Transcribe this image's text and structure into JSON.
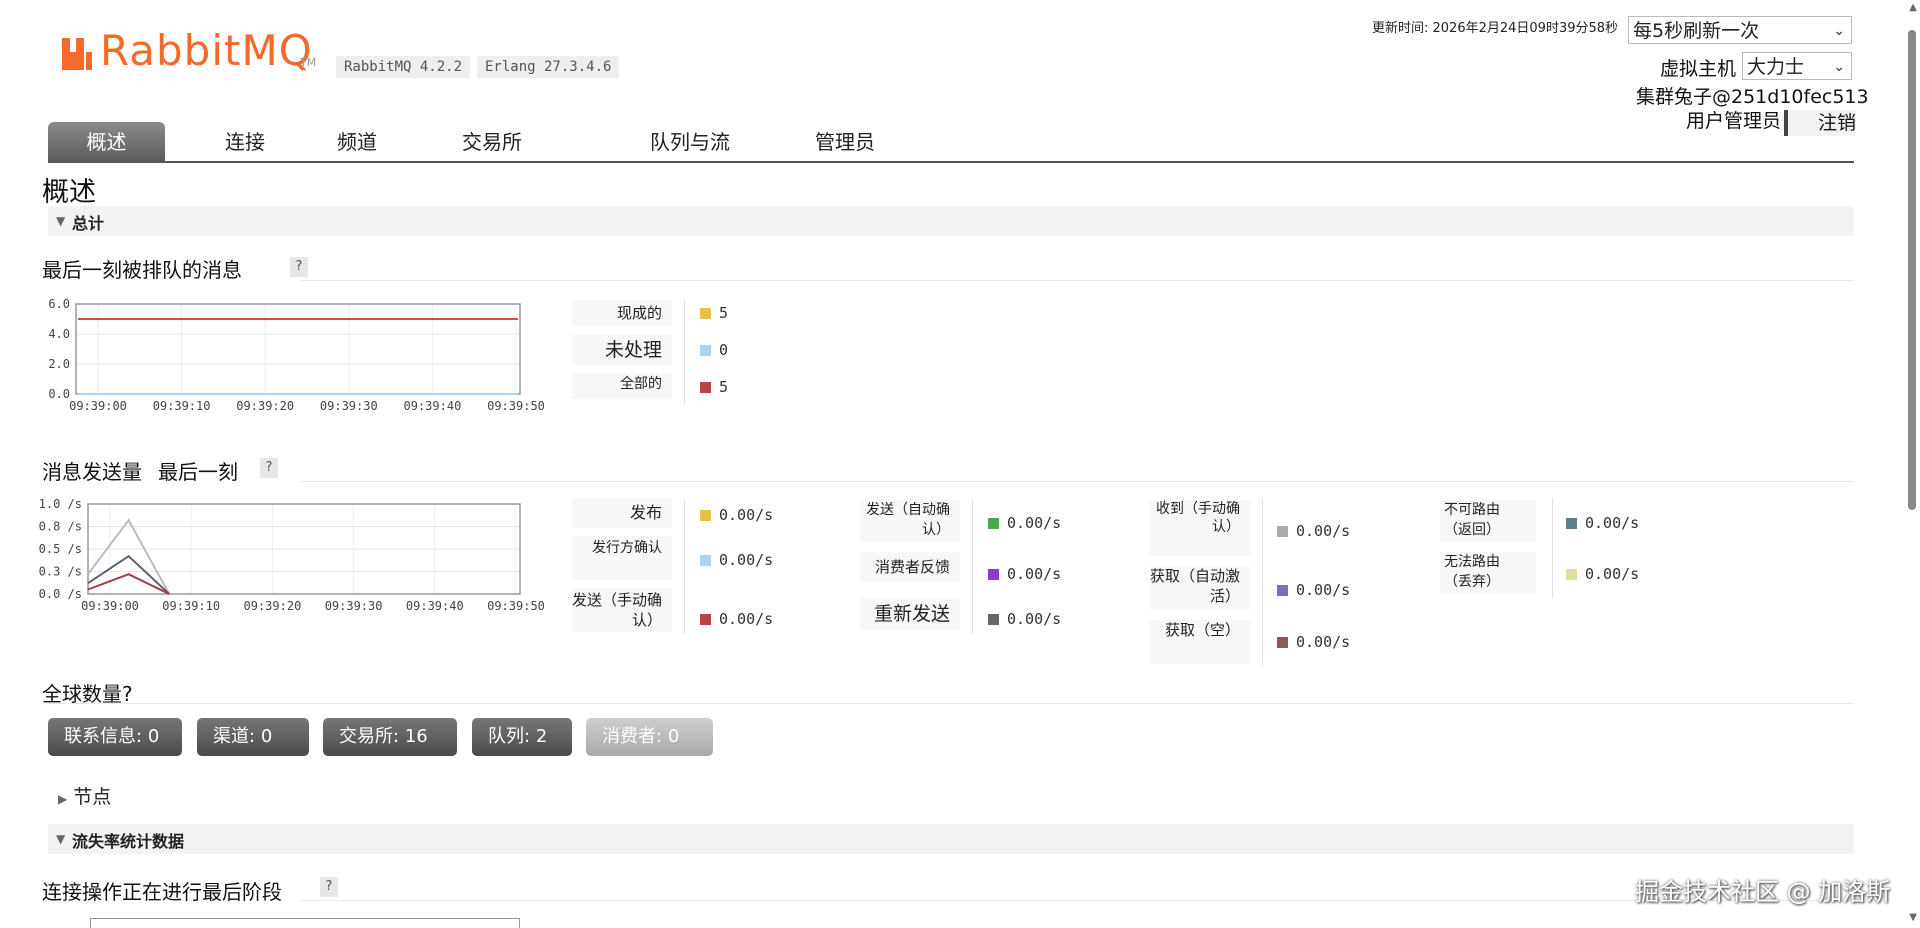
{
  "header": {
    "logo_text": "RabbitMQ",
    "logo_tm": "TM",
    "version": "RabbitMQ 4.2.2",
    "erlang": "Erlang 27.3.4.6",
    "update_time": "更新时间: 2026年2月24日09时39分58秒",
    "refresh_select": "每5秒刷新一次",
    "vhost_label": "虚拟主机",
    "vhost_value": "大力士",
    "cluster": "集群兔子@251d10fec513",
    "user": "用户管理员",
    "logout": "注销"
  },
  "tabs": [
    {
      "label": "概述",
      "active": true
    },
    {
      "label": "连接"
    },
    {
      "label": "频道"
    },
    {
      "label": "交易所"
    },
    {
      "label": "队列与流"
    },
    {
      "label": "管理员"
    }
  ],
  "page_title": "概述",
  "section_totals": "总计",
  "queued": {
    "title": "最后一刻被排队的消息",
    "help": "?",
    "legend": [
      {
        "label": "现成的",
        "value": "5",
        "color": "#e8c047"
      },
      {
        "label": "未处理",
        "value": "0",
        "color": "#aad4f0"
      },
      {
        "label": "全部的",
        "value": "5",
        "color": "#b84545"
      }
    ]
  },
  "rates": {
    "title": "消息发送量",
    "subtitle": "最后一刻",
    "help": "?",
    "legend": [
      {
        "label": "发布",
        "value": "0.00/s",
        "color": "#e8c047"
      },
      {
        "label": "发行方确认",
        "value": "0.00/s",
        "color": "#aad4f0"
      },
      {
        "label": "发送（手动确认）",
        "value": "0.00/s",
        "color": "#b84545"
      },
      {
        "label": "发送（自动确认）",
        "value": "0.00/s",
        "color": "#4aaa4a"
      },
      {
        "label": "消费者反馈",
        "value": "0.00/s",
        "color": "#8a3ccf"
      },
      {
        "label": "重新发送",
        "value": "0.00/s",
        "color": "#666666"
      },
      {
        "label": "收到（手动确认）",
        "value": "0.00/s",
        "color": "#aaaaaa"
      },
      {
        "label": "获取（自动激活）",
        "value": "0.00/s",
        "color": "#7a6fbf"
      },
      {
        "label": "获取（空）",
        "value": "0.00/s",
        "color": "#8a5a5a"
      },
      {
        "label": "不可路由（返回）",
        "value": "0.00/s",
        "color": "#5f7f8f"
      },
      {
        "label": "无法路由（丢弃）",
        "value": "0.00/s",
        "color": "#dede9e"
      }
    ]
  },
  "global_counts": {
    "title": "全球数量?",
    "items": [
      {
        "label": "联系信息:",
        "value": "0"
      },
      {
        "label": "渠道:",
        "value": "0"
      },
      {
        "label": "交易所:",
        "value": "16"
      },
      {
        "label": "队列:",
        "value": "2"
      },
      {
        "label": "消费者:",
        "value": "0"
      }
    ]
  },
  "nodes_label": "节点",
  "section_churn": "流失率统计数据",
  "churn": {
    "title": "连接操作正在进行最后阶段",
    "help": "?"
  },
  "watermark": "掘金技术社区 @ 加洛斯",
  "chart_data": [
    {
      "type": "line",
      "title": "最后一刻被排队的消息",
      "x": [
        "09:39:00",
        "09:39:10",
        "09:39:20",
        "09:39:30",
        "09:39:40",
        "09:39:50"
      ],
      "yticks": [
        "6.0",
        "4.0",
        "2.0",
        "0.0"
      ],
      "ylim": [
        0,
        6
      ],
      "series": [
        {
          "name": "现成的",
          "color": "#e8c047",
          "values": [
            5,
            5,
            5,
            5,
            5,
            5
          ]
        },
        {
          "name": "未处理",
          "color": "#aad4f0",
          "values": [
            0,
            0,
            0,
            0,
            0,
            0
          ]
        },
        {
          "name": "全部的",
          "color": "#d04c3c",
          "values": [
            5,
            5,
            5,
            5,
            5,
            5
          ]
        }
      ]
    },
    {
      "type": "line",
      "title": "消息发送量",
      "x": [
        "09:39:00",
        "09:39:10",
        "09:39:20",
        "09:39:30",
        "09:39:40",
        "09:39:50"
      ],
      "yticks": [
        "1.0 /s",
        "0.8 /s",
        "0.5 /s",
        "0.3 /s",
        "0.0 /s"
      ],
      "ylim": [
        0,
        1
      ],
      "series": [
        {
          "name": "发布",
          "color": "#bbbbbb",
          "points": [
            [
              0,
              0.22
            ],
            [
              5,
              0.82
            ],
            [
              10,
              0
            ]
          ]
        },
        {
          "name": "发行方确认",
          "color": "#5f5f7a",
          "points": [
            [
              0,
              0.12
            ],
            [
              5,
              0.42
            ],
            [
              10,
              0
            ]
          ]
        },
        {
          "name": "发送（手动确认）",
          "color": "#9c3c4c",
          "points": [
            [
              0,
              0.05
            ],
            [
              5,
              0.22
            ],
            [
              10,
              0
            ]
          ]
        }
      ]
    }
  ]
}
